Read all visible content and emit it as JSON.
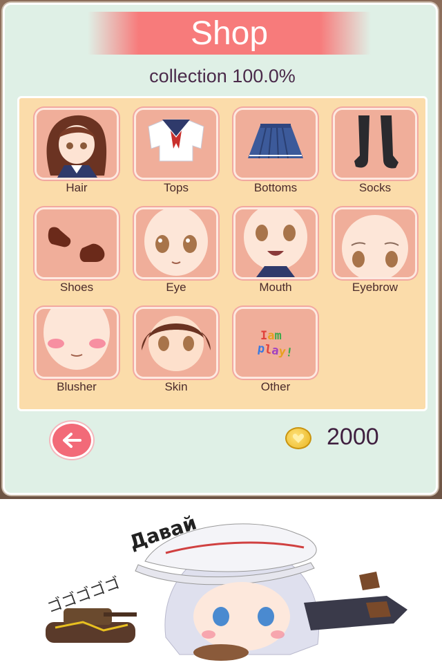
{
  "shop": {
    "title": "Shop",
    "collection_text": "collection 100.0%",
    "items": [
      {
        "label": "Hair",
        "icon": "hair-icon"
      },
      {
        "label": "Tops",
        "icon": "sailor-top-icon"
      },
      {
        "label": "Bottoms",
        "icon": "pleated-skirt-icon"
      },
      {
        "label": "Socks",
        "icon": "stockings-icon"
      },
      {
        "label": "Shoes",
        "icon": "shoes-icon"
      },
      {
        "label": "Eye",
        "icon": "eye-face-icon"
      },
      {
        "label": "Mouth",
        "icon": "mouth-face-icon"
      },
      {
        "label": "Eyebrow",
        "icon": "eyebrow-face-icon"
      },
      {
        "label": "Blusher",
        "icon": "blusher-face-icon"
      },
      {
        "label": "Skin",
        "icon": "skin-face-icon"
      },
      {
        "label": "Other",
        "icon": "other-icon",
        "art_text": "Iam play!"
      }
    ],
    "coins": "2000"
  },
  "comic": {
    "shout_text": "Давай",
    "sfx_text": "ゴゴゴゴゴ"
  },
  "colors": {
    "banner": "#f77b7b",
    "panel": "#dff0e6",
    "grid_bg": "#fbdcaa",
    "tile": "#f4b8a4",
    "back_button": "#f26a78",
    "coin": "#f2c232"
  }
}
